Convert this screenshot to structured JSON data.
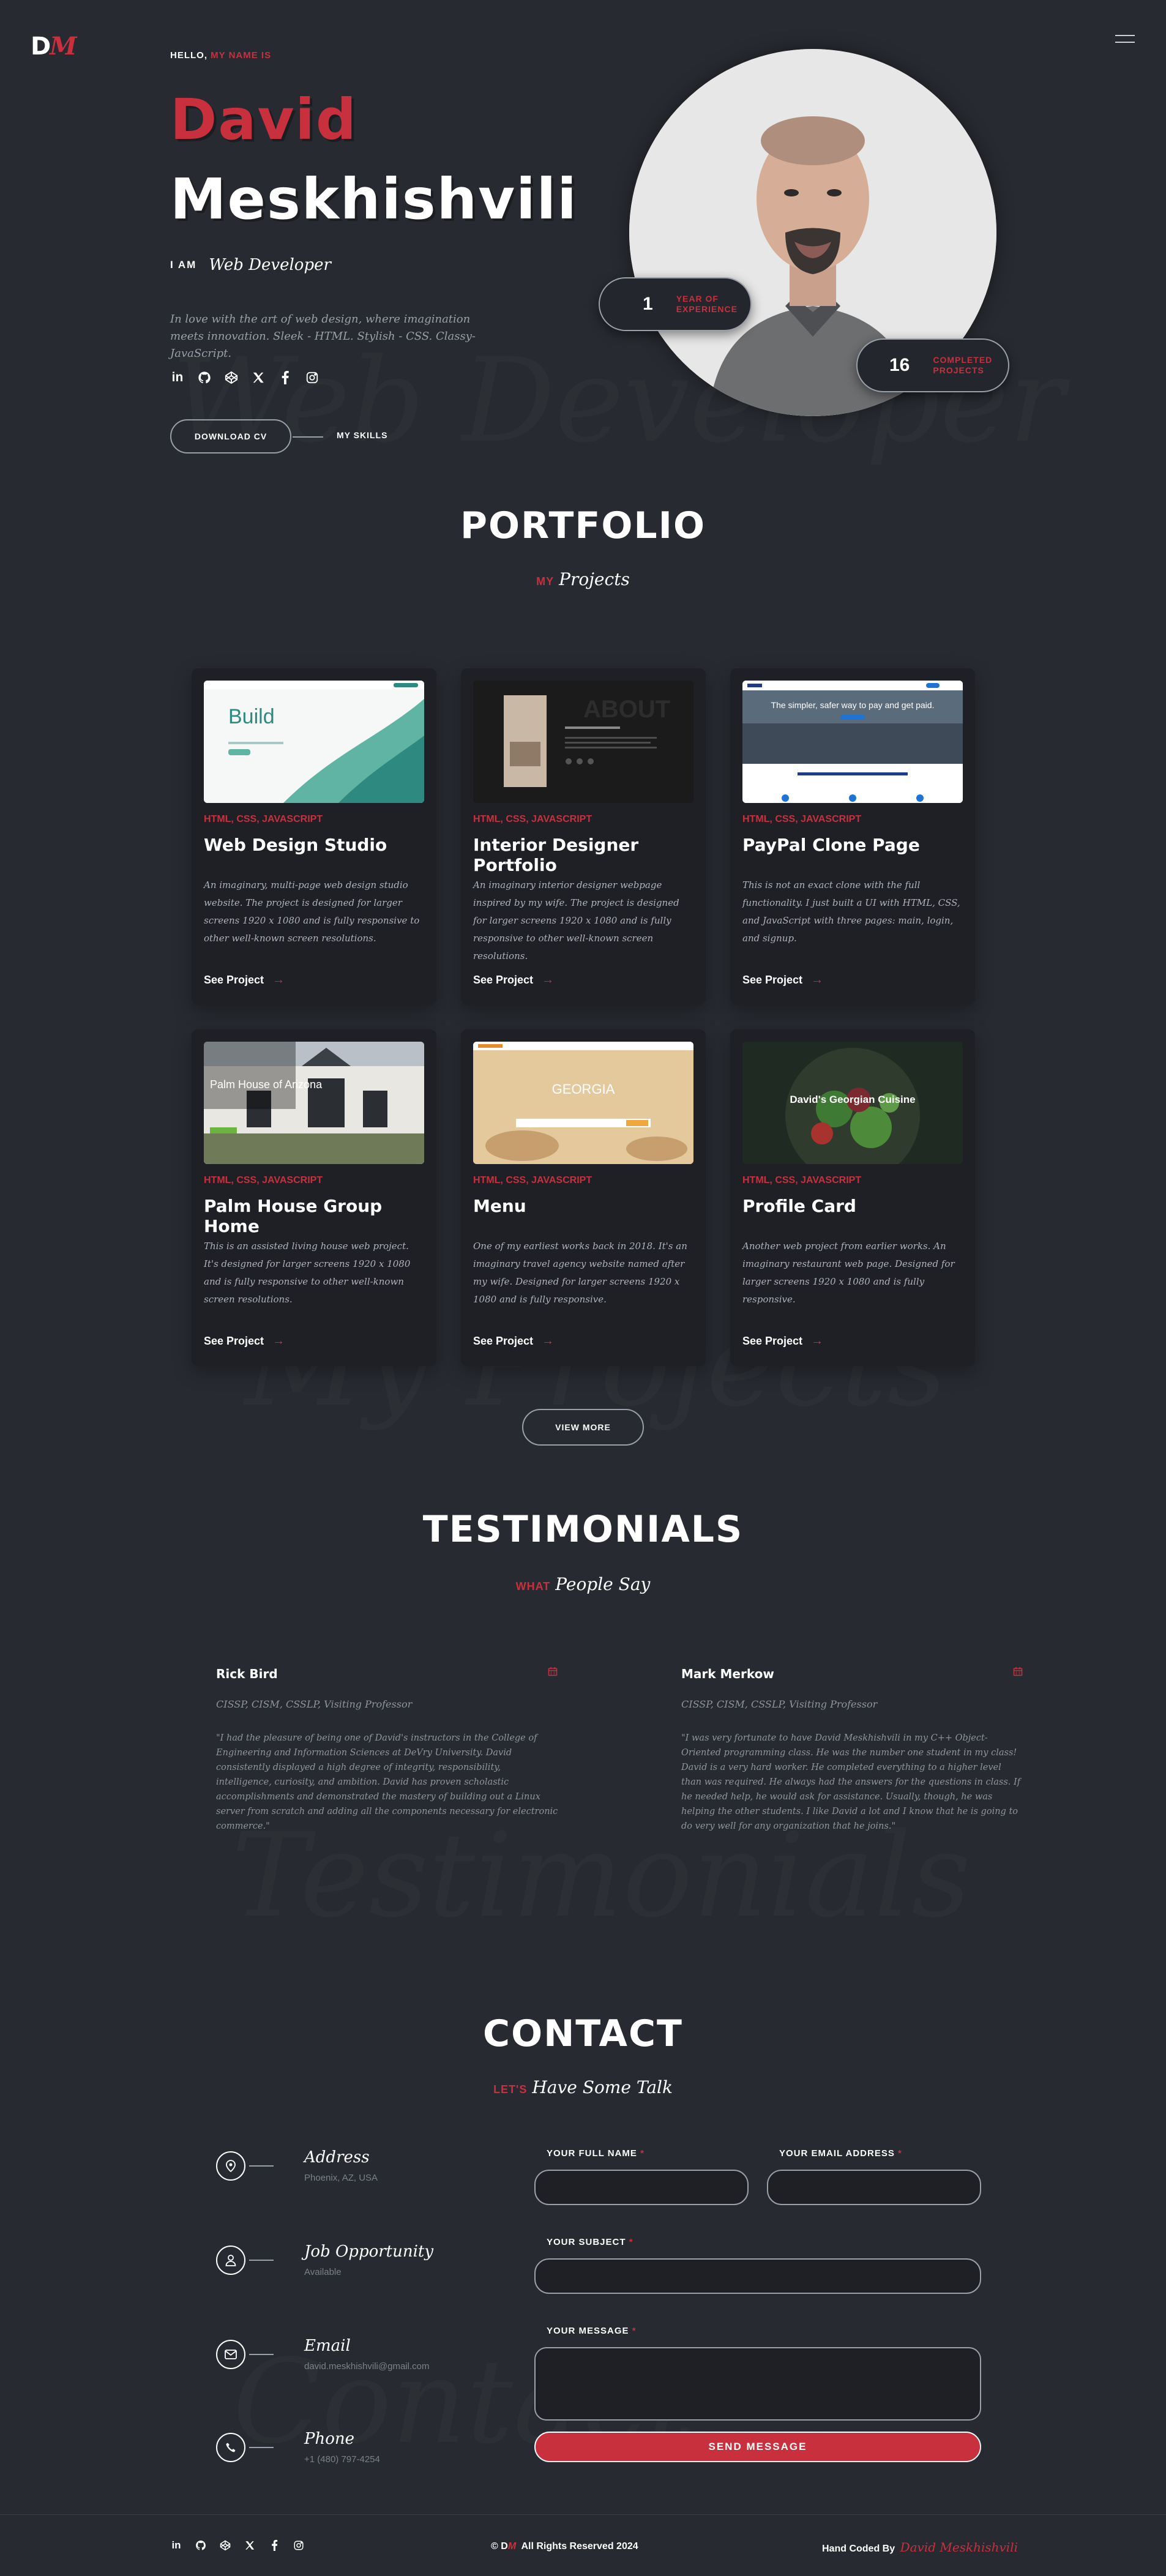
{
  "header": {
    "logo_d": "D",
    "logo_m": "M"
  },
  "hero": {
    "hello_prefix": "HELLO,",
    "hello_highlight": "MY NAME IS",
    "first_name": "David",
    "last_name": "Meskhishvili",
    "iam": "I AM",
    "role": "Web Developer",
    "tagline": "In love with the art of web design, where imagination meets innovation. Sleek - HTML. Stylish - CSS. Classy- JavaScript.",
    "background_word": "Web Developer",
    "download_cv": "DOWNLOAD CV",
    "my_skills": "MY SKILLS",
    "experience": {
      "number": "1",
      "label_line1": "YEAR OF",
      "label_line2": "EXPERIENCE"
    },
    "projects": {
      "number": "16",
      "label_line1": "COMPLETED",
      "label_line2": "PROJECTS"
    },
    "socials": [
      "linkedin-icon",
      "github-icon",
      "codepen-icon",
      "x-icon",
      "facebook-icon",
      "instagram-icon"
    ]
  },
  "portfolio": {
    "title": "PORTFOLIO",
    "sub_prefix": "MY",
    "sub_script": "Projects",
    "background_word": "My Projects",
    "see_project": "See Project",
    "view_more": "VIEW MORE",
    "cards": [
      {
        "tags": "HTML, CSS, JAVASCRIPT",
        "title": "Web Design Studio",
        "desc": "An imaginary, multi-page web design studio website. The project is designed for larger screens 1920 x 1080 and is fully responsive to other well-known screen resolutions.",
        "thumb_text": "Build"
      },
      {
        "tags": "HTML, CSS, JAVASCRIPT",
        "title": "Interior Designer Portfolio",
        "desc": "An imaginary interior designer webpage inspired by my wife. The project is designed for larger screens 1920 x 1080 and is fully responsive to other well-known screen resolutions.",
        "thumb_text": "ABOUT"
      },
      {
        "tags": "HTML, CSS, JAVASCRIPT",
        "title": "PayPal Clone Page",
        "desc": "This is not an exact clone with the full functionality. I just built a UI with HTML, CSS, and JavaScript with three pages: main, login, and signup.",
        "thumb_text": "The simpler, safer way to pay and get paid."
      },
      {
        "tags": "HTML, CSS, JAVASCRIPT",
        "title": "Palm House Group Home",
        "desc": "This is an assisted living house web project. It's designed for larger screens 1920 x 1080 and is fully responsive to other well-known screen resolutions.",
        "thumb_text": "Palm House of Arizona"
      },
      {
        "tags": "HTML, CSS, JAVASCRIPT",
        "title": "Menu",
        "desc": "One of my earliest works back in 2018. It's an imaginary travel agency website named after my wife. Designed for larger screens 1920 x 1080 and is fully responsive.",
        "thumb_text": "GEORGIA"
      },
      {
        "tags": "HTML, CSS, JAVASCRIPT",
        "title": "Profile Card",
        "desc": "Another web project from earlier works. An imaginary restaurant web page. Designed for larger screens 1920 x 1080 and is fully responsive.",
        "thumb_text": "David's Georgian Cuisine"
      }
    ]
  },
  "testimonials": {
    "title": "TESTIMONIALS",
    "sub_prefix": "WHAT",
    "sub_script": "People Say",
    "background_word": "Testimonials",
    "items": [
      {
        "name": "Rick Bird",
        "role": "CISSP, CISM, CSSLP, Visiting Professor",
        "quote": "\"I had the pleasure of being one of David's instructors in the College of Engineering and Information Sciences at DeVry University. David consistently displayed a high degree of integrity, responsibility, intelligence, curiosity, and ambition. David has proven scholastic accomplishments and demonstrated the mastery of building out a Linux server from scratch and adding all the components necessary for electronic commerce.\""
      },
      {
        "name": "Mark Merkow",
        "role": "CISSP, CISM, CSSLP, Visiting Professor",
        "quote": "\"I was very fortunate to have David Meskhishvili in my C++ Object-Oriented programming class. He was the number one student in my class! David is a very hard worker. He completed everything to a higher level than was required. He always had the answers for the questions in class. If he needed help, he would ask for assistance. Usually, though, he was helping the other students. I like David a lot and I know that he is going to do very well for any organization that he joins.\""
      }
    ]
  },
  "contact": {
    "title": "CONTACT",
    "sub_prefix": "LET'S",
    "sub_script": "Have Some Talk",
    "background_word": "Contact",
    "info": [
      {
        "title": "Address",
        "value": "Phoenix, AZ, USA",
        "icon": "map-pin-icon"
      },
      {
        "title": "Job Opportunity",
        "value": "Available",
        "icon": "user-icon"
      },
      {
        "title": "Email",
        "value": "david.meskhishvili@gmail.com",
        "icon": "mail-icon"
      },
      {
        "title": "Phone",
        "value": "+1 (480) 797-4254",
        "icon": "phone-icon"
      }
    ],
    "form": {
      "name_label": "YOUR FULL NAME",
      "email_label": "YOUR EMAIL ADDRESS",
      "subject_label": "YOUR SUBJECT",
      "message_label": "YOUR MESSAGE",
      "required_mark": "*",
      "send_label": "SEND MESSAGE"
    }
  },
  "footer": {
    "copyright_symbol": "©",
    "copyright_d": "D",
    "copyright_m": "M",
    "copyright_text": "All Rights Reserved 2024",
    "handcoded": "Hand Coded By",
    "author": "David Meskhishvili"
  },
  "colors": {
    "background": "#272a30",
    "card": "#1e2026",
    "accent": "#c8303e"
  }
}
